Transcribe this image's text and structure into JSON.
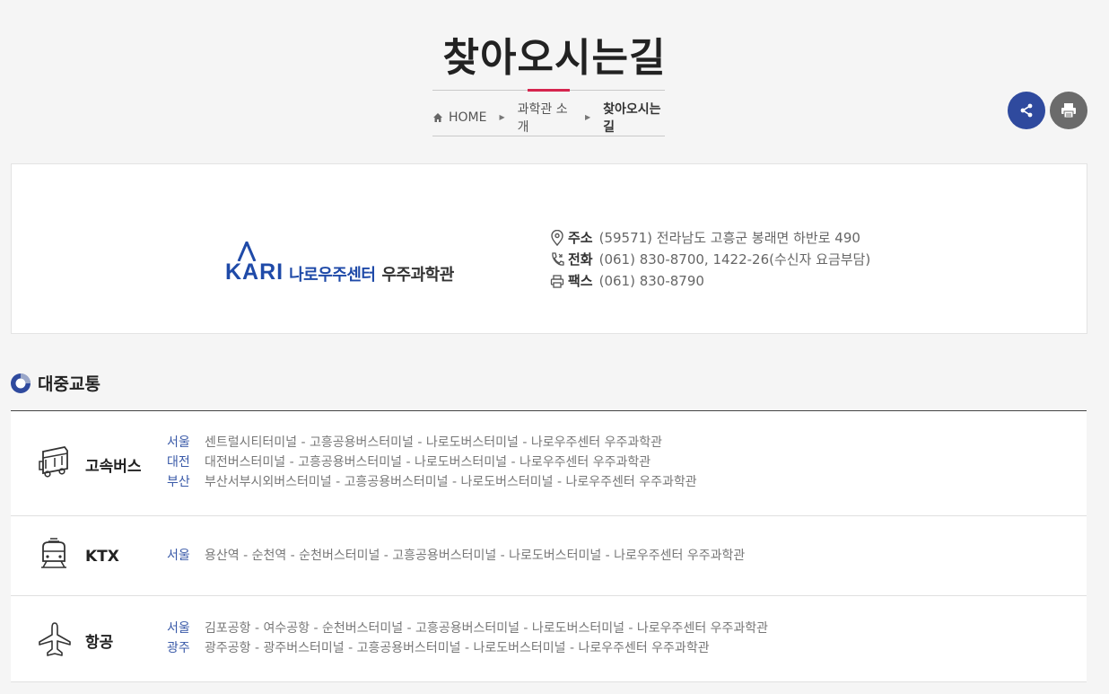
{
  "page": {
    "title": "찾아오시는길",
    "accent_color": "#d6254e"
  },
  "breadcrumb": {
    "home_icon": "home-icon",
    "items": [
      "HOME",
      "과학관 소개",
      "찾아오시는길"
    ]
  },
  "actions": {
    "share_icon": "share-icon",
    "share_color": "#2f4a9e",
    "print_icon": "printer-icon",
    "print_color": "#6b6b6b"
  },
  "info": {
    "logo": {
      "kari": "KARI",
      "center": "나로우주센터",
      "museum": "우주과학관"
    },
    "address": {
      "icon": "location-pin-icon",
      "label": "주소",
      "value": "(59571) 전라남도 고흥군 봉래면 하반로 490"
    },
    "phone": {
      "icon": "phone-icon",
      "label": "전화",
      "value": "(061) 830-8700, 1422-26(수신자 요금부담)"
    },
    "fax": {
      "icon": "fax-icon",
      "label": "팩스",
      "value": "(061) 830-8790"
    }
  },
  "transit": {
    "section_title": "대중교통",
    "section_icon": "donut-bullet-icon",
    "modes": [
      {
        "icon": "bus-icon",
        "name": "고속버스",
        "routes": [
          {
            "city": "서울",
            "path": "센트럴시티터미널 - 고흥공용버스터미널 - 나로도버스터미널 - 나로우주센터 우주과학관"
          },
          {
            "city": "대전",
            "path": "대전버스터미널 - 고흥공용버스터미널 - 나로도버스터미널 - 나로우주센터 우주과학관"
          },
          {
            "city": "부산",
            "path": "부산서부시외버스터미널 - 고흥공용버스터미널 - 나로도버스터미널 - 나로우주센터 우주과학관"
          }
        ]
      },
      {
        "icon": "train-icon",
        "name": "KTX",
        "routes": [
          {
            "city": "서울",
            "path": "용산역 - 순천역 - 순천버스터미널 - 고흥공용버스터미널 - 나로도버스터미널 - 나로우주센터 우주과학관"
          }
        ]
      },
      {
        "icon": "airplane-icon",
        "name": "항공",
        "routes": [
          {
            "city": "서울",
            "path": "김포공항 - 여수공항 - 순천버스터미널 - 고흥공용버스터미널 - 나로도버스터미널 - 나로우주센터 우주과학관"
          },
          {
            "city": "광주",
            "path": "광주공항 - 광주버스터미널 - 고흥공용버스터미널 - 나로도버스터미널 - 나로우주센터 우주과학관"
          }
        ]
      }
    ]
  }
}
